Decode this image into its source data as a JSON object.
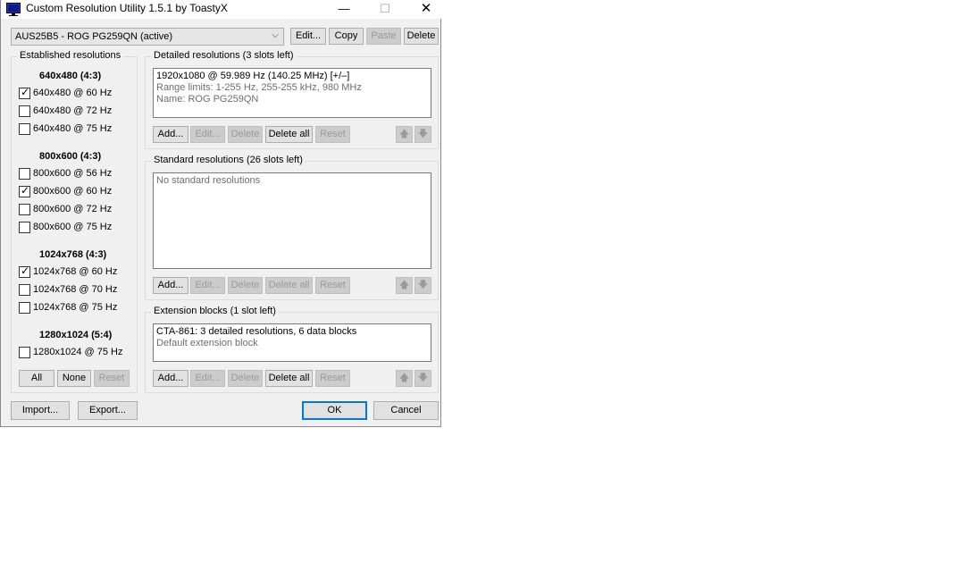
{
  "window": {
    "title": "Custom Resolution Utility 1.5.1 by ToastyX",
    "minimize_glyph": "—",
    "maximize_glyph": "☐",
    "close_glyph": "✕"
  },
  "monitor_select": {
    "value": "AUS25B5 - ROG PG259QN (active)",
    "arrow": "⌵"
  },
  "top_buttons": {
    "edit": "Edit...",
    "copy": "Copy",
    "paste": "Paste",
    "delete": "Delete"
  },
  "established": {
    "title": "Established resolutions",
    "groups": [
      {
        "header": "640x480 (4:3)",
        "items": [
          {
            "label": "640x480 @ 60 Hz",
            "checked": true
          },
          {
            "label": "640x480 @ 72 Hz",
            "checked": false
          },
          {
            "label": "640x480 @ 75 Hz",
            "checked": false
          }
        ]
      },
      {
        "header": "800x600 (4:3)",
        "items": [
          {
            "label": "800x600 @ 56 Hz",
            "checked": false
          },
          {
            "label": "800x600 @ 60 Hz",
            "checked": true
          },
          {
            "label": "800x600 @ 72 Hz",
            "checked": false
          },
          {
            "label": "800x600 @ 75 Hz",
            "checked": false
          }
        ]
      },
      {
        "header": "1024x768 (4:3)",
        "items": [
          {
            "label": "1024x768 @ 60 Hz",
            "checked": true
          },
          {
            "label": "1024x768 @ 70 Hz",
            "checked": false
          },
          {
            "label": "1024x768 @ 75 Hz",
            "checked": false
          }
        ]
      },
      {
        "header": "1280x1024 (5:4)",
        "items": [
          {
            "label": "1280x1024 @ 75 Hz",
            "checked": false
          }
        ]
      }
    ],
    "buttons": {
      "all": "All",
      "none": "None",
      "reset": "Reset"
    }
  },
  "detailed": {
    "title": "Detailed resolutions (3 slots left)",
    "line1": "1920x1080 @ 59.989 Hz (140.25 MHz) [+/–]",
    "line2": "Range limits: 1-255 Hz, 255-255 kHz, 980 MHz",
    "line3": "Name: ROG PG259QN"
  },
  "standard": {
    "title": "Standard resolutions (26 slots left)",
    "empty": "No standard resolutions"
  },
  "extension": {
    "title": "Extension blocks (1 slot left)",
    "line1": "CTA-861: 3 detailed resolutions, 6 data blocks",
    "line2": "Default extension block"
  },
  "list_buttons": {
    "add": "Add...",
    "edit": "Edit...",
    "delete": "Delete",
    "delete_all": "Delete all",
    "reset": "Reset",
    "up": "🡅",
    "down": "🡇"
  },
  "bottom_buttons": {
    "import": "Import...",
    "export": "Export...",
    "ok": "OK",
    "cancel": "Cancel"
  },
  "colors": {
    "accent": "#0078d7",
    "window_bg": "#f0f0f0",
    "app_icon": "#1f3fbf"
  }
}
